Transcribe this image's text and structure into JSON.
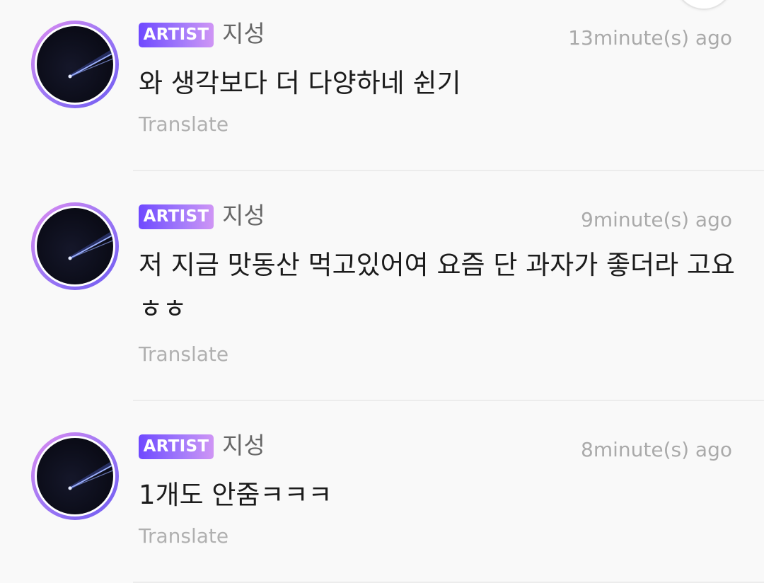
{
  "comments": [
    {
      "badge": "ARTIST",
      "author": "지성",
      "time": "13minute(s) ago",
      "text": "와 생각보다 더 다양하네 쉰기",
      "translate": "Translate"
    },
    {
      "badge": "ARTIST",
      "author": "지성",
      "time": "9minute(s) ago",
      "text": "저 지금 맛동산 먹고있어여 요즘 단 과자가 좋더라 고요ㅎㅎ",
      "translate": "Translate"
    },
    {
      "badge": "ARTIST",
      "author": "지성",
      "time": "8minute(s) ago",
      "text": "1개도 안줌ㅋㅋㅋ",
      "translate": "Translate"
    }
  ],
  "colors": {
    "badge_gradient_start": "#6f49ff",
    "badge_gradient_end": "#cf95f5",
    "avatar_ring_start": "#e08cf0",
    "avatar_ring_end": "#6f5bf2",
    "text": "#1c1c1c",
    "muted": "#aaaaaa",
    "background": "#f9f9f9"
  },
  "icons": {
    "avatar": "meteor-avatar-image",
    "top": "floating-action-circle"
  }
}
